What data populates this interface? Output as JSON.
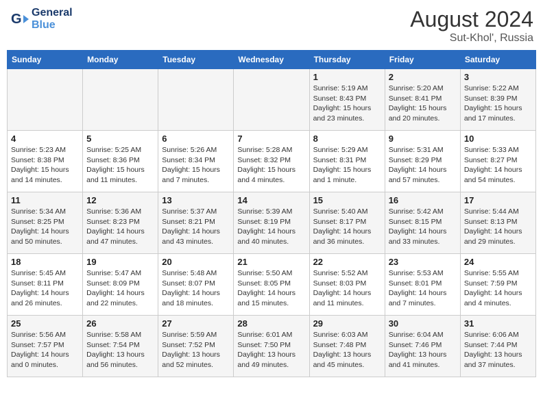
{
  "header": {
    "logo_line1": "General",
    "logo_line2": "Blue",
    "month_year": "August 2024",
    "location": "Sut-Khol', Russia"
  },
  "weekdays": [
    "Sunday",
    "Monday",
    "Tuesday",
    "Wednesday",
    "Thursday",
    "Friday",
    "Saturday"
  ],
  "weeks": [
    [
      {
        "day": "",
        "text": ""
      },
      {
        "day": "",
        "text": ""
      },
      {
        "day": "",
        "text": ""
      },
      {
        "day": "",
        "text": ""
      },
      {
        "day": "1",
        "text": "Sunrise: 5:19 AM\nSunset: 8:43 PM\nDaylight: 15 hours\nand 23 minutes."
      },
      {
        "day": "2",
        "text": "Sunrise: 5:20 AM\nSunset: 8:41 PM\nDaylight: 15 hours\nand 20 minutes."
      },
      {
        "day": "3",
        "text": "Sunrise: 5:22 AM\nSunset: 8:39 PM\nDaylight: 15 hours\nand 17 minutes."
      }
    ],
    [
      {
        "day": "4",
        "text": "Sunrise: 5:23 AM\nSunset: 8:38 PM\nDaylight: 15 hours\nand 14 minutes."
      },
      {
        "day": "5",
        "text": "Sunrise: 5:25 AM\nSunset: 8:36 PM\nDaylight: 15 hours\nand 11 minutes."
      },
      {
        "day": "6",
        "text": "Sunrise: 5:26 AM\nSunset: 8:34 PM\nDaylight: 15 hours\nand 7 minutes."
      },
      {
        "day": "7",
        "text": "Sunrise: 5:28 AM\nSunset: 8:32 PM\nDaylight: 15 hours\nand 4 minutes."
      },
      {
        "day": "8",
        "text": "Sunrise: 5:29 AM\nSunset: 8:31 PM\nDaylight: 15 hours\nand 1 minute."
      },
      {
        "day": "9",
        "text": "Sunrise: 5:31 AM\nSunset: 8:29 PM\nDaylight: 14 hours\nand 57 minutes."
      },
      {
        "day": "10",
        "text": "Sunrise: 5:33 AM\nSunset: 8:27 PM\nDaylight: 14 hours\nand 54 minutes."
      }
    ],
    [
      {
        "day": "11",
        "text": "Sunrise: 5:34 AM\nSunset: 8:25 PM\nDaylight: 14 hours\nand 50 minutes."
      },
      {
        "day": "12",
        "text": "Sunrise: 5:36 AM\nSunset: 8:23 PM\nDaylight: 14 hours\nand 47 minutes."
      },
      {
        "day": "13",
        "text": "Sunrise: 5:37 AM\nSunset: 8:21 PM\nDaylight: 14 hours\nand 43 minutes."
      },
      {
        "day": "14",
        "text": "Sunrise: 5:39 AM\nSunset: 8:19 PM\nDaylight: 14 hours\nand 40 minutes."
      },
      {
        "day": "15",
        "text": "Sunrise: 5:40 AM\nSunset: 8:17 PM\nDaylight: 14 hours\nand 36 minutes."
      },
      {
        "day": "16",
        "text": "Sunrise: 5:42 AM\nSunset: 8:15 PM\nDaylight: 14 hours\nand 33 minutes."
      },
      {
        "day": "17",
        "text": "Sunrise: 5:44 AM\nSunset: 8:13 PM\nDaylight: 14 hours\nand 29 minutes."
      }
    ],
    [
      {
        "day": "18",
        "text": "Sunrise: 5:45 AM\nSunset: 8:11 PM\nDaylight: 14 hours\nand 26 minutes."
      },
      {
        "day": "19",
        "text": "Sunrise: 5:47 AM\nSunset: 8:09 PM\nDaylight: 14 hours\nand 22 minutes."
      },
      {
        "day": "20",
        "text": "Sunrise: 5:48 AM\nSunset: 8:07 PM\nDaylight: 14 hours\nand 18 minutes."
      },
      {
        "day": "21",
        "text": "Sunrise: 5:50 AM\nSunset: 8:05 PM\nDaylight: 14 hours\nand 15 minutes."
      },
      {
        "day": "22",
        "text": "Sunrise: 5:52 AM\nSunset: 8:03 PM\nDaylight: 14 hours\nand 11 minutes."
      },
      {
        "day": "23",
        "text": "Sunrise: 5:53 AM\nSunset: 8:01 PM\nDaylight: 14 hours\nand 7 minutes."
      },
      {
        "day": "24",
        "text": "Sunrise: 5:55 AM\nSunset: 7:59 PM\nDaylight: 14 hours\nand 4 minutes."
      }
    ],
    [
      {
        "day": "25",
        "text": "Sunrise: 5:56 AM\nSunset: 7:57 PM\nDaylight: 14 hours\nand 0 minutes."
      },
      {
        "day": "26",
        "text": "Sunrise: 5:58 AM\nSunset: 7:54 PM\nDaylight: 13 hours\nand 56 minutes."
      },
      {
        "day": "27",
        "text": "Sunrise: 5:59 AM\nSunset: 7:52 PM\nDaylight: 13 hours\nand 52 minutes."
      },
      {
        "day": "28",
        "text": "Sunrise: 6:01 AM\nSunset: 7:50 PM\nDaylight: 13 hours\nand 49 minutes."
      },
      {
        "day": "29",
        "text": "Sunrise: 6:03 AM\nSunset: 7:48 PM\nDaylight: 13 hours\nand 45 minutes."
      },
      {
        "day": "30",
        "text": "Sunrise: 6:04 AM\nSunset: 7:46 PM\nDaylight: 13 hours\nand 41 minutes."
      },
      {
        "day": "31",
        "text": "Sunrise: 6:06 AM\nSunset: 7:44 PM\nDaylight: 13 hours\nand 37 minutes."
      }
    ]
  ]
}
